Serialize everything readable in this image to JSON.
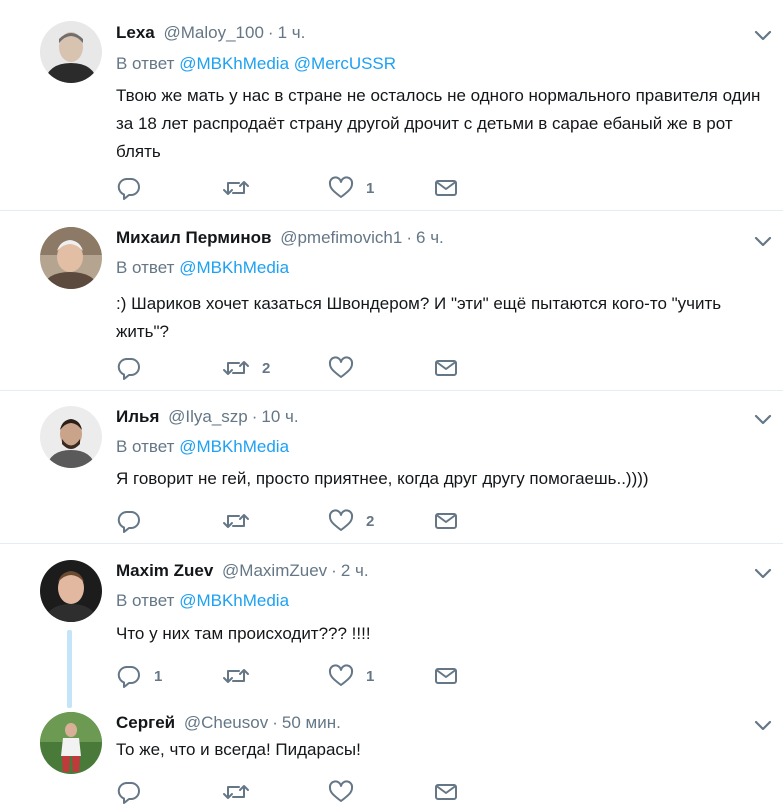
{
  "tweets": [
    {
      "name": "Lexa",
      "handle": "@Maloy_100",
      "dot": "·",
      "time": "1 ч.",
      "reply_prefix": "В ответ",
      "mentions": [
        "@MBKhMedia",
        "@MercUSSR"
      ],
      "text": "Твою же мать у нас в стране не осталось не одного нормального правителя один за 18 лет распродаёт страну другой дрочит с детьми в сарае ебаный же в рот блять",
      "reply_count": "",
      "retweet_count": "",
      "like_count": "1"
    },
    {
      "name": "Михаил Перминов",
      "handle": "@pmefimovich1",
      "dot": "·",
      "time": "6 ч.",
      "reply_prefix": "В ответ",
      "mentions": [
        "@MBKhMedia"
      ],
      "text": ":) Шариков хочет казаться Швондером? И \"эти\" ещё пытаются кого-то \"учить жить\"?",
      "reply_count": "",
      "retweet_count": "2",
      "like_count": ""
    },
    {
      "name": "Илья",
      "handle": "@Ilya_szp",
      "dot": "·",
      "time": "10 ч.",
      "reply_prefix": "В ответ",
      "mentions": [
        "@MBKhMedia"
      ],
      "text": "Я говорит не гей, просто приятнее, когда друг другу помогаешь..))))",
      "reply_count": "",
      "retweet_count": "",
      "like_count": "2"
    },
    {
      "name": "Maxim Zuev",
      "handle": "@MaximZuev",
      "dot": "·",
      "time": "2 ч.",
      "reply_prefix": "В ответ",
      "mentions": [
        "@MBKhMedia"
      ],
      "text": "Что у них там происходит??? !!!!",
      "reply_count": "1",
      "retweet_count": "",
      "like_count": "1"
    },
    {
      "name": "Сергей",
      "handle": "@Cheusov",
      "dot": "·",
      "time": "50 мин.",
      "text": "То же, что и всегда! Пидарасы!",
      "reply_count": "",
      "retweet_count": "",
      "like_count": ""
    }
  ],
  "icons": {
    "reply": "reply-icon",
    "retweet": "retweet-icon",
    "like": "heart-icon",
    "dm": "envelope-icon",
    "more": "chevron-down-icon"
  },
  "colors": {
    "link": "#1da1f2",
    "muted": "#657786",
    "text": "#14171a",
    "divider": "#e6ecf0",
    "thread_line": "#c4e4f9"
  }
}
